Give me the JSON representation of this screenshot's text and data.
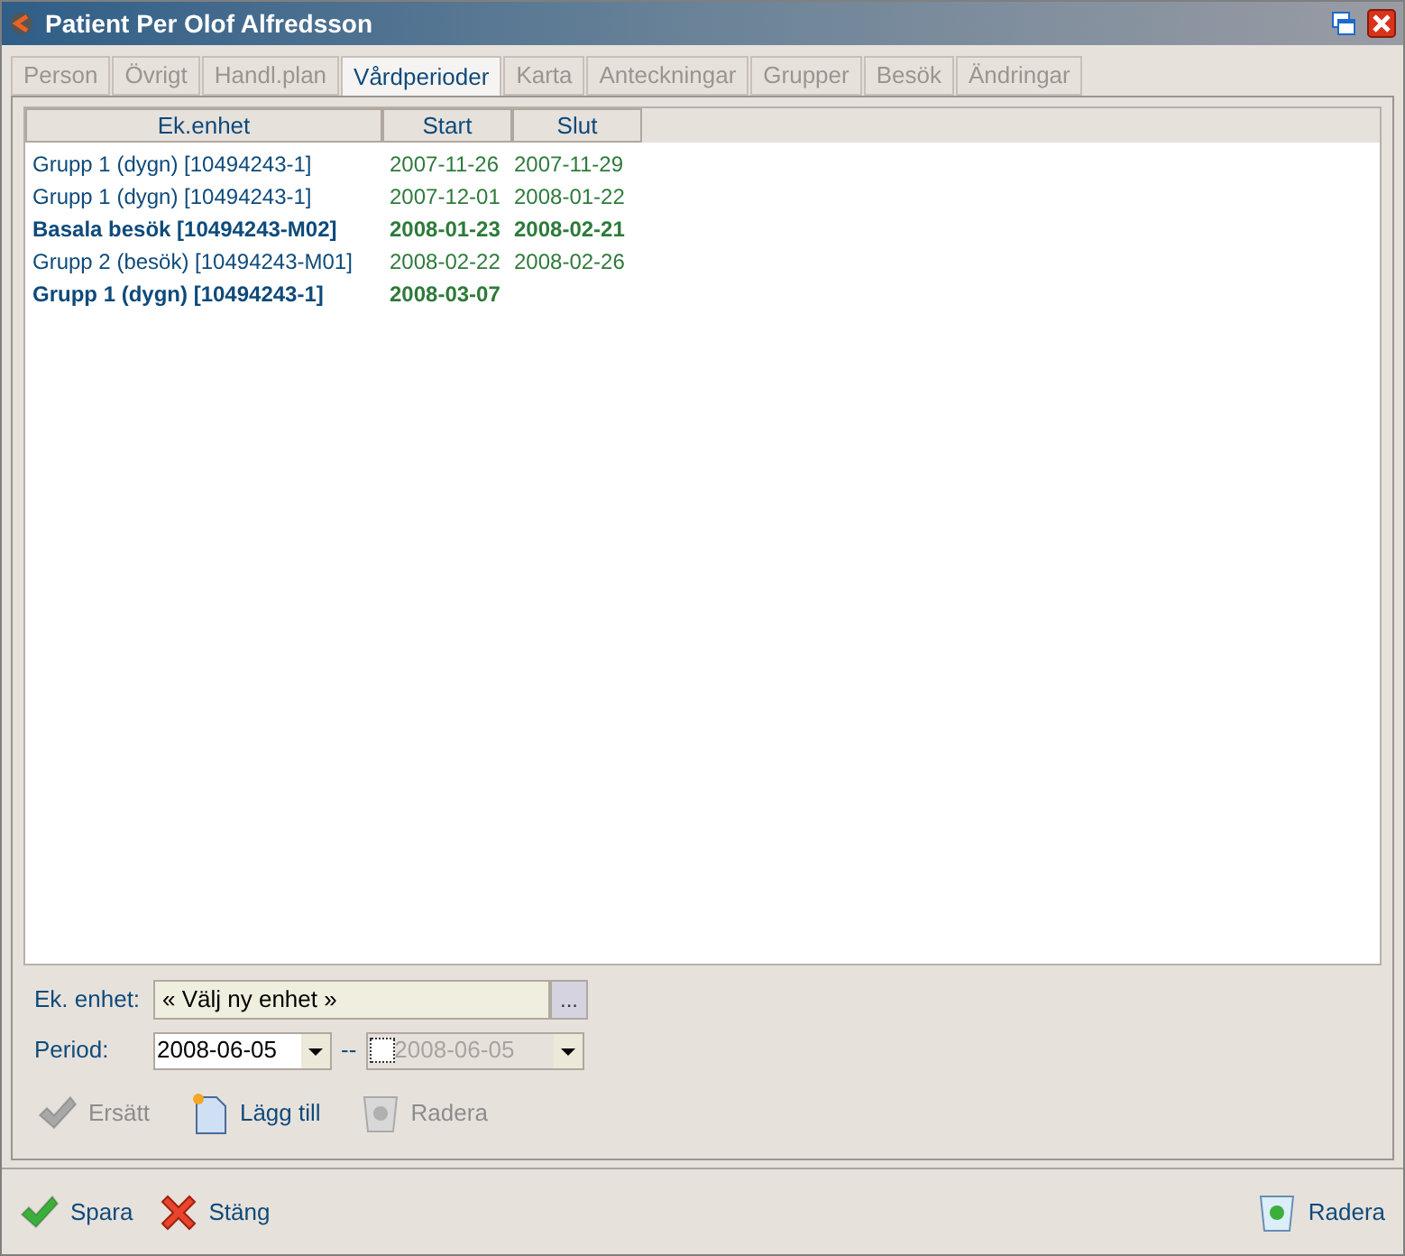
{
  "window": {
    "title": "Patient Per Olof Alfredsson"
  },
  "tabs": [
    {
      "label": "Person",
      "selected": false
    },
    {
      "label": "Övrigt",
      "selected": false
    },
    {
      "label": "Handl.plan",
      "selected": false
    },
    {
      "label": "Vårdperioder",
      "selected": true
    },
    {
      "label": "Karta",
      "selected": false
    },
    {
      "label": "Anteckningar",
      "selected": false
    },
    {
      "label": "Grupper",
      "selected": false
    },
    {
      "label": "Besök",
      "selected": false
    },
    {
      "label": "Ändringar",
      "selected": false
    }
  ],
  "table": {
    "columns": [
      "Ek.enhet",
      "Start",
      "Slut"
    ],
    "rows": [
      {
        "unit": "Grupp 1 (dygn) [10494243-1]",
        "start": "2007-11-26",
        "end": "2007-11-29",
        "bold": false
      },
      {
        "unit": "Grupp 1 (dygn) [10494243-1]",
        "start": "2007-12-01",
        "end": "2008-01-22",
        "bold": false
      },
      {
        "unit": "Basala besök [10494243-M02]",
        "start": "2008-01-23",
        "end": "2008-02-21",
        "bold": true
      },
      {
        "unit": "Grupp 2 (besök) [10494243-M01]",
        "start": "2008-02-22",
        "end": "2008-02-26",
        "bold": false
      },
      {
        "unit": "Grupp 1 (dygn) [10494243-1]",
        "start": "2008-03-07",
        "bold": true
      }
    ]
  },
  "form": {
    "unit_label": "Ek. enhet:",
    "unit_value": "« Välj ny enhet »",
    "browse": "...",
    "period_label": "Period:",
    "from": "2008-06-05",
    "separator": "--",
    "to": "2008-06-05",
    "to_checked": false
  },
  "actions": [
    {
      "kind": "replace",
      "label": "Ersätt",
      "disabled": true
    },
    {
      "kind": "add",
      "label": "Lägg till",
      "disabled": false
    },
    {
      "kind": "delete",
      "label": "Radera",
      "disabled": true
    }
  ],
  "footer": {
    "save": "Spara",
    "close": "Stäng",
    "delete": "Radera"
  }
}
